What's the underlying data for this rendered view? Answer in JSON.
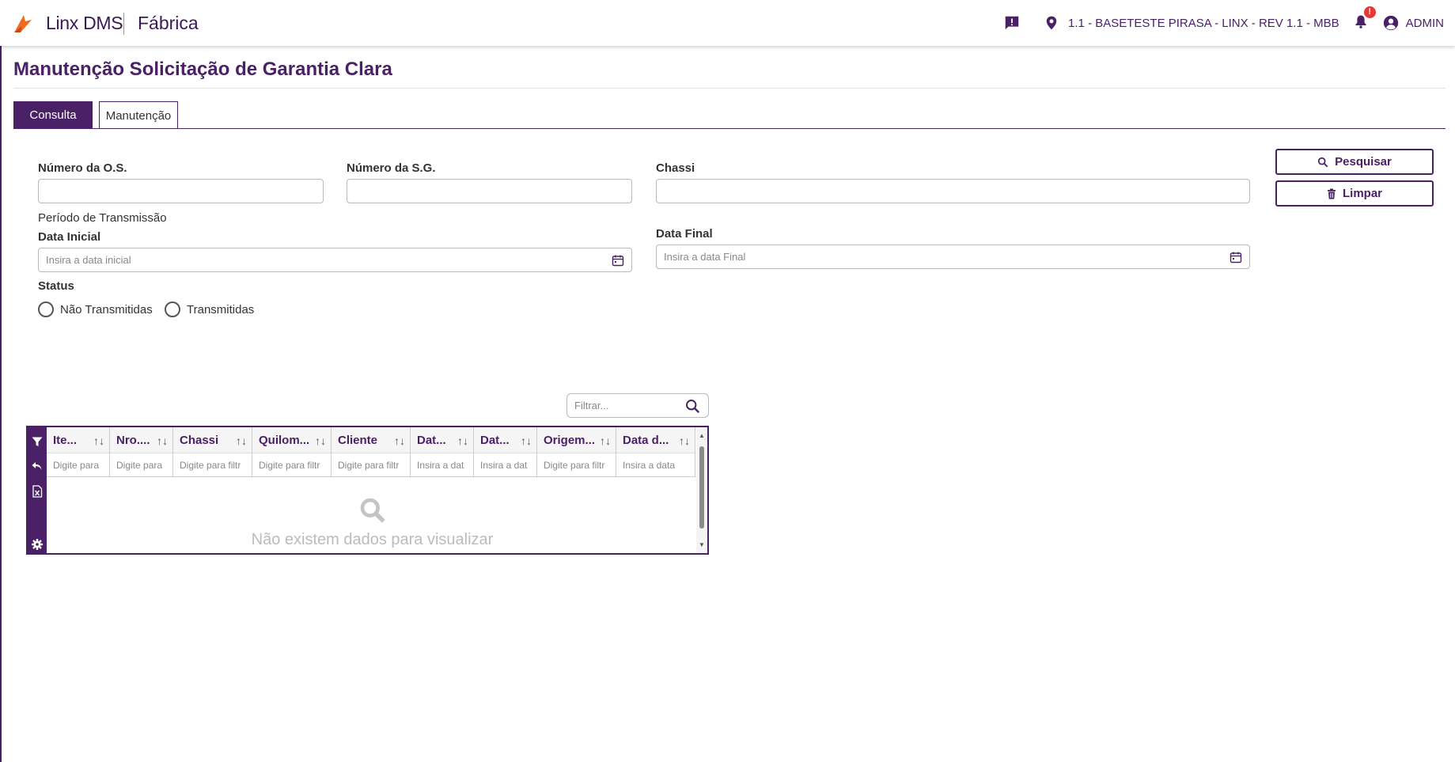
{
  "header": {
    "brand": "Linx DMS",
    "module": "Fábrica",
    "location": "1.1 - BASETESTE PIRASA - LINX - REV 1.1 - MBB",
    "notification_badge": "!",
    "user": "ADMIN"
  },
  "page": {
    "title": "Manutenção Solicitação de Garantia Clara"
  },
  "tabs": [
    {
      "label": "Consulta",
      "active": true
    },
    {
      "label": "Manutenção",
      "active": false
    }
  ],
  "form": {
    "os_label": "Número da O.S.",
    "os_value": "",
    "sg_label": "Número da S.G.",
    "sg_value": "",
    "chassi_label": "Chassi",
    "chassi_value": "",
    "period_label": "Período de Transmissão",
    "start_label": "Data Inicial",
    "start_placeholder": "Insira a data inicial",
    "end_label": "Data Final",
    "end_placeholder": "Insira a data Final",
    "status_label": "Status",
    "status_options": [
      "Não Transmitidas",
      "Transmitidas"
    ]
  },
  "actions": {
    "search_label": "Pesquisar",
    "clear_label": "Limpar"
  },
  "grid": {
    "filter_placeholder": "Filtrar...",
    "columns": [
      {
        "header": "Ite...",
        "filter": "Digite para"
      },
      {
        "header": "Nro....",
        "filter": "Digite para"
      },
      {
        "header": "Chassi",
        "filter": "Digite para filtr"
      },
      {
        "header": "Quilom...",
        "filter": "Digite para filtr"
      },
      {
        "header": "Cliente",
        "filter": "Digite para filtr"
      },
      {
        "header": "Dat...",
        "filter": "Insira a dat"
      },
      {
        "header": "Dat...",
        "filter": "Insira a dat"
      },
      {
        "header": "Origem...",
        "filter": "Digite para filtr"
      },
      {
        "header": "Data d...",
        "filter": "Insira a data"
      }
    ],
    "sort_glyph": "↑↓",
    "empty_message": "Não existem dados para visualizar"
  },
  "colors": {
    "primary": "#4a2066",
    "accent_orange": "#f26b1d",
    "badge": "#e53935"
  }
}
